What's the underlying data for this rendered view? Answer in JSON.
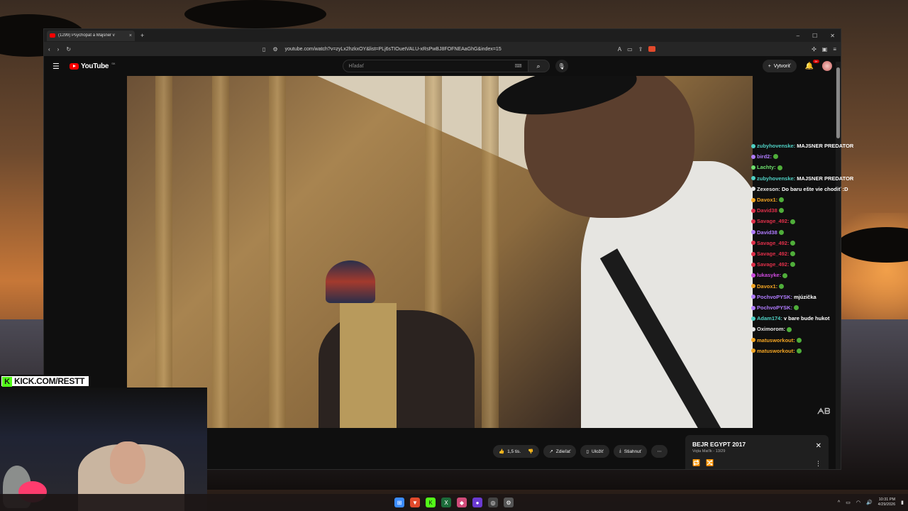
{
  "browser": {
    "tab_title": "(1299) Psychopat a Majsner v",
    "tab_close": "×",
    "new_tab": "+",
    "url": "youtube.com/watch?v=zyLx2hzkxOY&list=PLj6sTIOuetVALU-xRsPwBJ8FOFNEAaGhG&index=15",
    "window_controls": [
      "–",
      "☐",
      "✕"
    ]
  },
  "youtube": {
    "logo_text": "YouTube",
    "logo_suffix": "SK",
    "search_placeholder": "Hľadať",
    "create_label": "Vytvoriť",
    "notification_count": "9+"
  },
  "chat": [
    {
      "user": "zubyhovenske:",
      "msg": "MAJSNER PREDATOR",
      "color": "#4fd1c5"
    },
    {
      "user": "bird2:",
      "msg": "",
      "color": "#b07cff"
    },
    {
      "user": "Lachty:",
      "msg": "",
      "color": "#6ee06e"
    },
    {
      "user": "zubyhovenske:",
      "msg": "MAJSNER PREDATOR",
      "color": "#4fd1c5"
    },
    {
      "user": "Zexeson:",
      "msg": "Do baru ešte vie chodiť :D",
      "color": "#e6e6e6"
    },
    {
      "user": "Davox1:",
      "msg": "",
      "color": "#f5a623"
    },
    {
      "user": "David38",
      "msg": "",
      "color": "#e0304a"
    },
    {
      "user": "Savage_492:",
      "msg": "",
      "color": "#e0304a"
    },
    {
      "user": "David38",
      "msg": "",
      "color": "#b07cff"
    },
    {
      "user": "Savage_492:",
      "msg": "",
      "color": "#e0304a"
    },
    {
      "user": "Savage_492:",
      "msg": "",
      "color": "#e0304a"
    },
    {
      "user": "Savage_492:",
      "msg": "",
      "color": "#e0304a"
    },
    {
      "user": "lukasyke:",
      "msg": "",
      "color": "#d04be0"
    },
    {
      "user": "Davox1:",
      "msg": "",
      "color": "#f5a623"
    },
    {
      "user": "PochvoPYSK:",
      "msg": "mjúzička",
      "color": "#b07cff"
    },
    {
      "user": "PochvoPYSK:",
      "msg": "",
      "color": "#b07cff"
    },
    {
      "user": "Adam174:",
      "msg": "v bare bude hukot",
      "color": "#4fd1c5"
    },
    {
      "user": "Oximorom:",
      "msg": "",
      "color": "#e6e6e6"
    },
    {
      "user": "matusworkout:",
      "msg": "",
      "color": "#f5a623"
    },
    {
      "user": "matusworkout:",
      "msg": "",
      "color": "#f5a623"
    }
  ],
  "actions": {
    "like_count": "1,5 tis.",
    "share": "Zdieľať",
    "save": "Uložiť",
    "download": "Stiahnuť",
    "more": "⋯"
  },
  "playlist": {
    "title": "BEJR EGYPT 2017",
    "subtitle": "Vojta Maťík - 13/29"
  },
  "overlay": {
    "kick_text": "KICK.COM/RESTT"
  },
  "taskbar": {
    "time": "10:31 PM",
    "date": "4/29/2026"
  }
}
